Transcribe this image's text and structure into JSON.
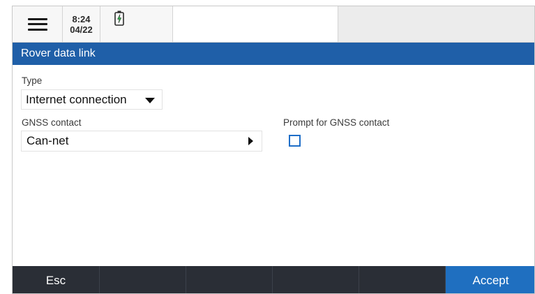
{
  "status_bar": {
    "time": "8:24",
    "date": "04/22",
    "menu_icon": "hamburger-menu-icon",
    "battery_icon": "battery-charging-icon",
    "battery_accent": "#2db84a"
  },
  "screen": {
    "title": "Rover data link"
  },
  "form": {
    "type_label": "Type",
    "type_value": "Internet connection",
    "gnss_contact_label": "GNSS contact",
    "gnss_contact_value": "Can-net",
    "prompt_label": "Prompt for GNSS contact",
    "prompt_checked": false
  },
  "bottom_bar": {
    "esc_label": "Esc",
    "accept_label": "Accept"
  },
  "colors": {
    "title_bar": "#1f5fa8",
    "bottom_bar": "#2a2e36",
    "accept_button": "#1f6fc0",
    "checkbox_border": "#1e6ec8"
  }
}
